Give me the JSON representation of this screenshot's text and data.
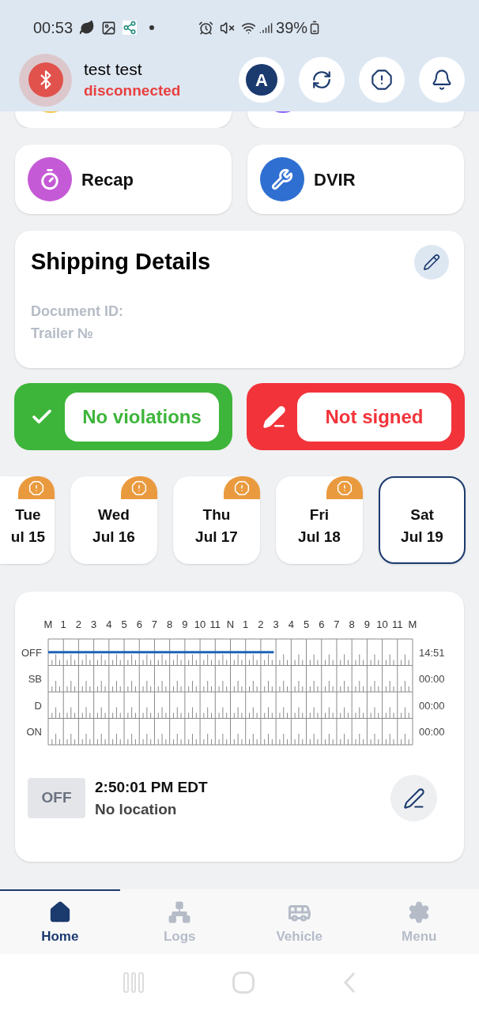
{
  "status_bar": {
    "time": "00:53",
    "battery": "39%"
  },
  "header": {
    "user_name": "test test",
    "connection": "disconnected",
    "connected": false,
    "avatar_letter": "A"
  },
  "hidden_cards": [
    {
      "color": "#f5c542"
    },
    {
      "color": "#8b5cf6"
    }
  ],
  "shortcuts": [
    {
      "kind": "recap",
      "label": "Recap",
      "color": "#c55ad6"
    },
    {
      "kind": "dvir",
      "label": "DVIR",
      "color": "#2f6fd1"
    }
  ],
  "shipping": {
    "title": "Shipping Details",
    "fields": [
      "Document ID:",
      "Trailer №"
    ]
  },
  "status_buttons": [
    {
      "kind": "check",
      "label": "No violations",
      "color": "#3db53a"
    },
    {
      "kind": "sign",
      "label": "Not signed",
      "color": "#f2333a"
    }
  ],
  "days": [
    {
      "day": "Tue",
      "date": "ul 15",
      "warning": true,
      "selected": false,
      "partial": true
    },
    {
      "day": "Wed",
      "date": "Jul 16",
      "warning": true,
      "selected": false,
      "partial": false
    },
    {
      "day": "Thu",
      "date": "Jul 17",
      "warning": true,
      "selected": false,
      "partial": false
    },
    {
      "day": "Fri",
      "date": "Jul 18",
      "warning": true,
      "selected": false,
      "partial": false
    },
    {
      "day": "Sat",
      "date": "Jul 19",
      "warning": false,
      "selected": true,
      "partial": false
    }
  ],
  "log": {
    "hour_labels": [
      "M",
      "1",
      "2",
      "3",
      "4",
      "5",
      "6",
      "7",
      "8",
      "9",
      "10",
      "11",
      "N",
      "1",
      "2",
      "3",
      "4",
      "5",
      "6",
      "7",
      "8",
      "9",
      "10",
      "11",
      "M"
    ],
    "rows": [
      {
        "label": "OFF",
        "total": "14:51",
        "level": 0.619
      },
      {
        "label": "SB",
        "total": "00:00"
      },
      {
        "label": "D",
        "total": "00:00"
      },
      {
        "label": "ON",
        "total": "00:00"
      }
    ],
    "current_status": "OFF",
    "time": "2:50:01 PM EDT",
    "location": "No location"
  },
  "nav": [
    {
      "kind": "home",
      "label": "Home",
      "selected": true
    },
    {
      "kind": "logs",
      "label": "Logs",
      "selected": false
    },
    {
      "kind": "vehicle",
      "label": "Vehicle",
      "selected": false
    },
    {
      "kind": "menu",
      "label": "Menu",
      "selected": false
    }
  ]
}
